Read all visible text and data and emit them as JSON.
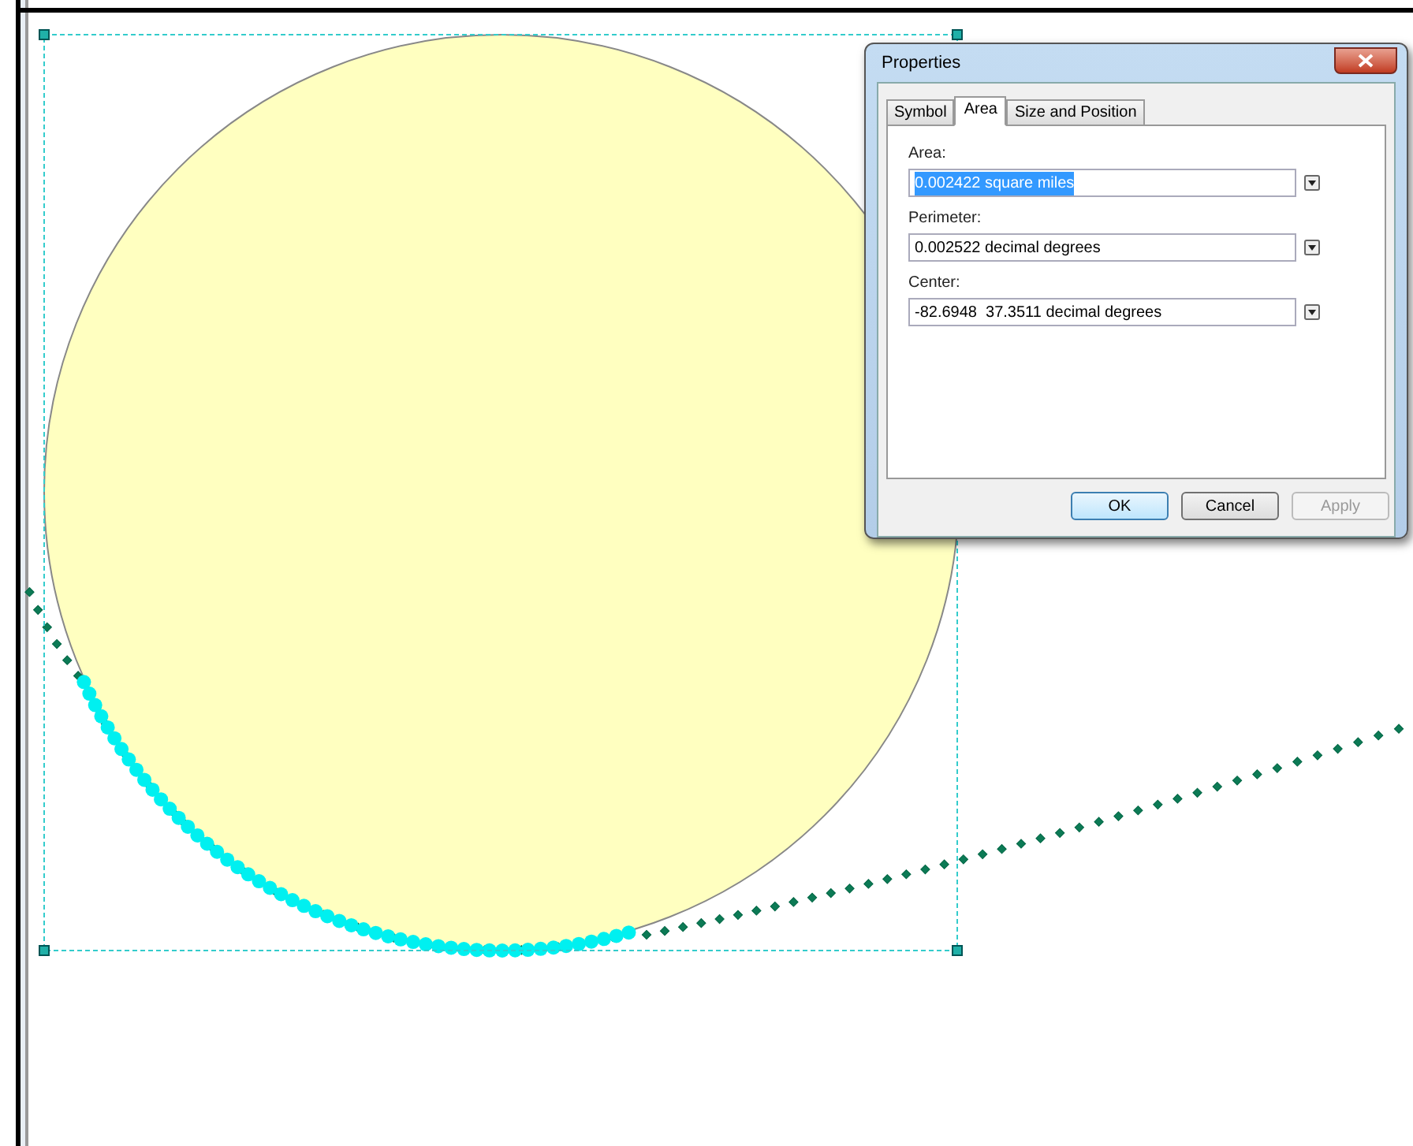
{
  "dialog": {
    "title": "Properties",
    "tabs": [
      {
        "label": "Symbol",
        "selected": false
      },
      {
        "label": "Area",
        "selected": true
      },
      {
        "label": "Size and Position",
        "selected": false
      }
    ],
    "fields": [
      {
        "label": "Area:",
        "value": "0.002422 square miles",
        "selected": true
      },
      {
        "label": "Perimeter:",
        "value": "0.002522 decimal degrees",
        "selected": false
      },
      {
        "label": "Center:",
        "value": "-82.6948  37.3511 decimal degrees",
        "selected": false
      }
    ],
    "buttons": [
      {
        "label": "OK",
        "default": true,
        "disabled": false
      },
      {
        "label": "Cancel",
        "default": false,
        "disabled": false
      },
      {
        "label": "Apply",
        "default": false,
        "disabled": true
      }
    ]
  }
}
